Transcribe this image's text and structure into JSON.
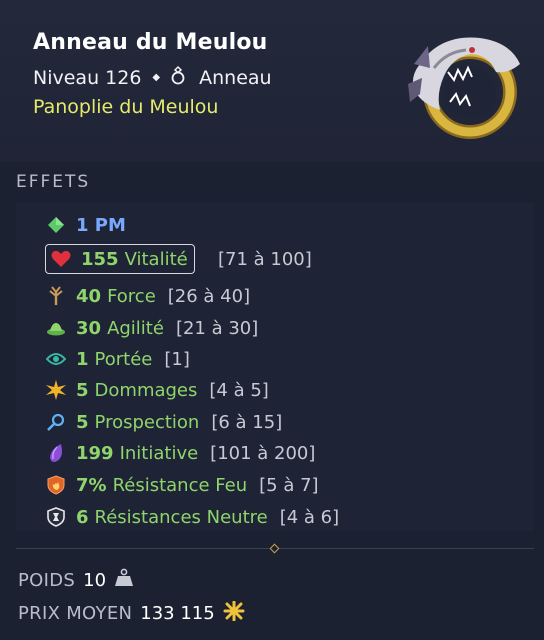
{
  "item": {
    "name": "Anneau du Meulou",
    "level": "Niveau 126",
    "type": "Anneau",
    "set": "Panoplie du Meulou"
  },
  "sections": {
    "effects_title": "EFFETS"
  },
  "effects": [
    {
      "icon": "pm-icon",
      "value": "1 PM",
      "label": "",
      "range": ""
    },
    {
      "icon": "vitality-heart-icon",
      "value": "155",
      "label": "Vitalité",
      "range": "[71 à 100]"
    },
    {
      "icon": "strength-icon",
      "value": "40",
      "label": "Force",
      "range": "[26 à 40]"
    },
    {
      "icon": "agility-icon",
      "value": "30",
      "label": "Agilité",
      "range": "[21 à 30]"
    },
    {
      "icon": "range-eye-icon",
      "value": "1",
      "label": "Portée",
      "range": "[1]"
    },
    {
      "icon": "damage-burst-icon",
      "value": "5",
      "label": "Dommages",
      "range": "[4 à 5]"
    },
    {
      "icon": "prospecting-magnifier-icon",
      "value": "5",
      "label": "Prospection",
      "range": "[6 à 15]"
    },
    {
      "icon": "initiative-icon",
      "value": "199",
      "label": "Initiative",
      "range": "[101 à 200]"
    },
    {
      "icon": "fire-resistance-icon",
      "value": "7%",
      "label": "Résistance Feu",
      "range": "[5 à 7]"
    },
    {
      "icon": "neutral-resistance-icon",
      "value": "6",
      "label": "Résistances Neutre",
      "range": "[4 à 6]"
    }
  ],
  "footer": {
    "weight_label": "POIDS",
    "weight_value": "10",
    "price_label": "PRIX MOYEN",
    "price_value": "133 115"
  },
  "colors": {
    "background": "#1b1f2e",
    "set_name": "#e6ea6c",
    "effect_positive": "#8fd46c",
    "effect_pm": "#7aa8ff"
  }
}
